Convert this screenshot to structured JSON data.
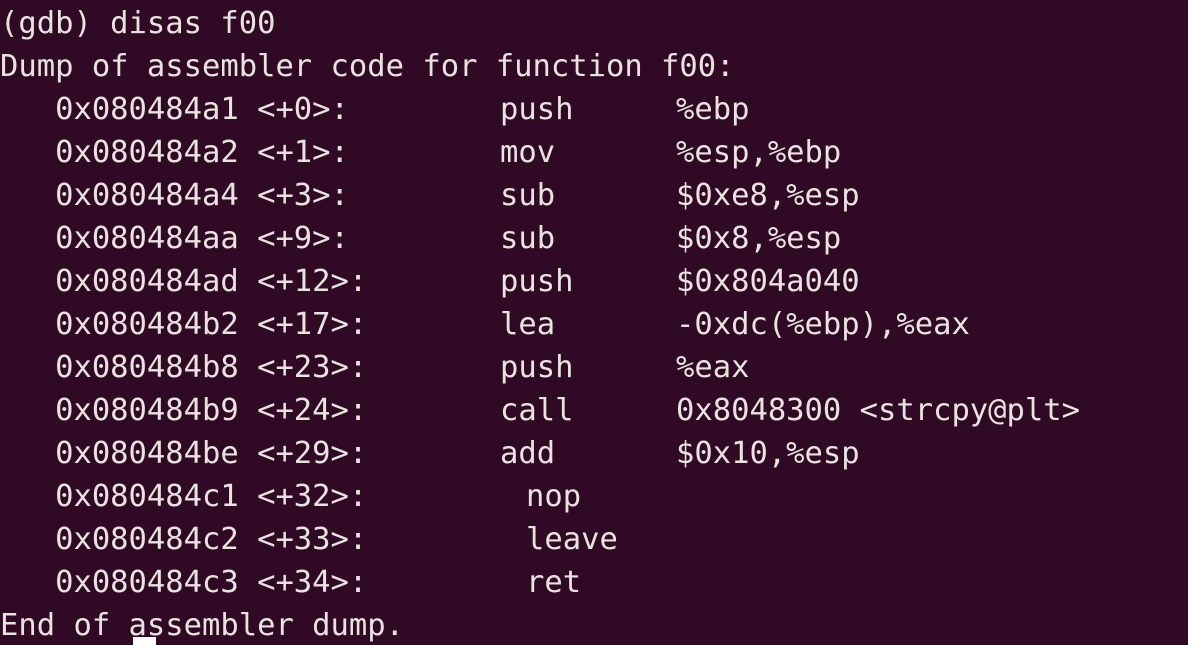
{
  "terminal": {
    "background_color": "#300a24",
    "foreground_color": "#e9e3e0",
    "cursor_color": "#ffffff"
  },
  "session": {
    "prompt": "(gdb) ",
    "command": "disas f00",
    "prompt_line": "(gdb) disas f00",
    "header_line": "Dump of assembler code for function f00:",
    "footer_line": "End of assembler dump."
  },
  "disassembly": {
    "function": "f00",
    "rows": [
      {
        "address": "   0x080484a1 <+0>:",
        "mnemonic": "push",
        "operands": "%ebp"
      },
      {
        "address": "   0x080484a2 <+1>:",
        "mnemonic": "mov",
        "operands": "%esp,%ebp"
      },
      {
        "address": "   0x080484a4 <+3>:",
        "mnemonic": "sub",
        "operands": "$0xe8,%esp"
      },
      {
        "address": "   0x080484aa <+9>:",
        "mnemonic": "sub",
        "operands": "$0x8,%esp"
      },
      {
        "address": "   0x080484ad <+12>:",
        "mnemonic": "push",
        "operands": "$0x804a040"
      },
      {
        "address": "   0x080484b2 <+17>:",
        "mnemonic": "lea",
        "operands": "-0xdc(%ebp),%eax"
      },
      {
        "address": "   0x080484b8 <+23>:",
        "mnemonic": "push",
        "operands": "%eax"
      },
      {
        "address": "   0x080484b9 <+24>:",
        "mnemonic": "call",
        "operands": "0x8048300 <strcpy@plt>"
      },
      {
        "address": "   0x080484be <+29>:",
        "mnemonic": "add",
        "operands": "$0x10,%esp"
      },
      {
        "address": "   0x080484c1 <+32>:",
        "mnemonic": "nop",
        "operands": ""
      },
      {
        "address": "   0x080484c2 <+33>:",
        "mnemonic": "leave",
        "operands": ""
      },
      {
        "address": "   0x080484c3 <+34>:",
        "mnemonic": "ret",
        "operands": ""
      }
    ]
  }
}
